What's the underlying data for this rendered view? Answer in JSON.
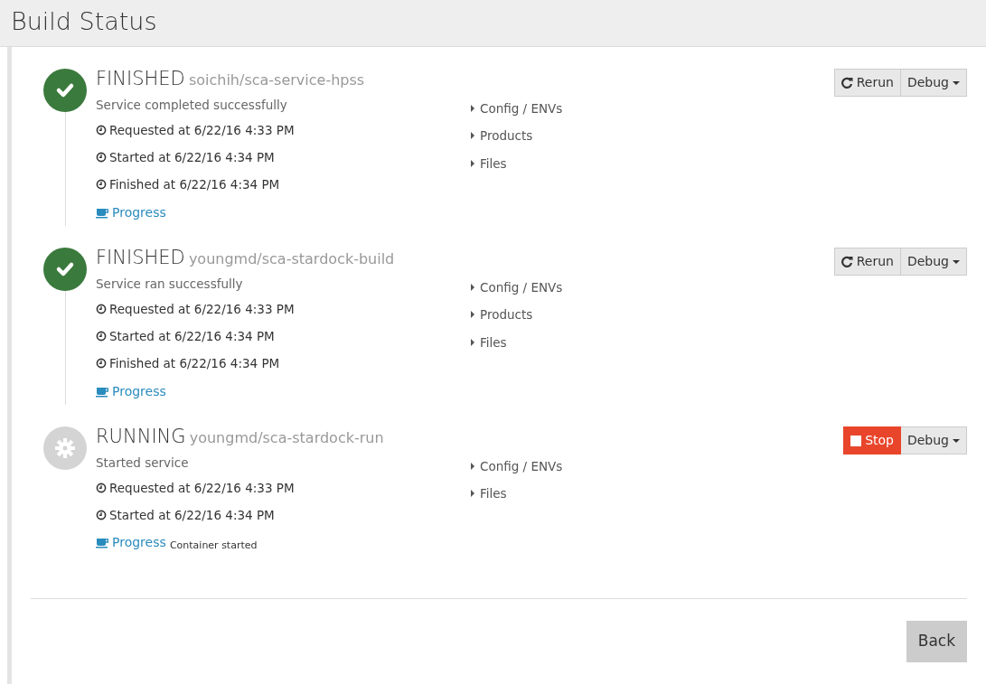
{
  "page_title": "Build Status",
  "jobs": [
    {
      "status": "FINISHED",
      "kind": "finished",
      "service": "soichih/sca-service-hpss",
      "message": "Service completed successfully",
      "times": [
        "Requested at 6/22/16 4:33 PM",
        "Started at 6/22/16 4:34 PM",
        "Finished at 6/22/16 4:34 PM"
      ],
      "progress": "Progress",
      "sections": [
        {
          "label": "Config / ENVs",
          "expanded": false
        },
        {
          "label": "Products",
          "expanded": false
        },
        {
          "label": "Files",
          "expanded": false
        }
      ],
      "action": {
        "kind": "rerun",
        "label": "Rerun"
      },
      "debug": "Debug"
    },
    {
      "status": "FINISHED",
      "kind": "finished",
      "service": "youngmd/sca-stardock-build",
      "message": "Service ran successfully",
      "times": [
        "Requested at 6/22/16 4:33 PM",
        "Started at 6/22/16 4:34 PM",
        "Finished at 6/22/16 4:34 PM"
      ],
      "progress": "Progress",
      "sections": [
        {
          "label": "Config / ENVs",
          "expanded": false
        },
        {
          "label": "Products",
          "expanded": false
        },
        {
          "label": "Files",
          "expanded": false
        }
      ],
      "action": {
        "kind": "rerun",
        "label": "Rerun"
      },
      "debug": "Debug"
    },
    {
      "status": "RUNNING",
      "kind": "running",
      "service": "youngmd/sca-stardock-run",
      "message": "Started service",
      "times": [
        "Requested at 6/22/16 4:33 PM",
        "Started at 6/22/16 4:34 PM"
      ],
      "progress": "Progress",
      "progress_note": "Container started",
      "sections": [
        {
          "label": "Config / ENVs",
          "expanded": false
        },
        {
          "label": "Files",
          "expanded": false
        }
      ],
      "action": {
        "kind": "stop",
        "label": "Stop"
      },
      "debug": "Debug"
    }
  ],
  "back_button": "Back"
}
